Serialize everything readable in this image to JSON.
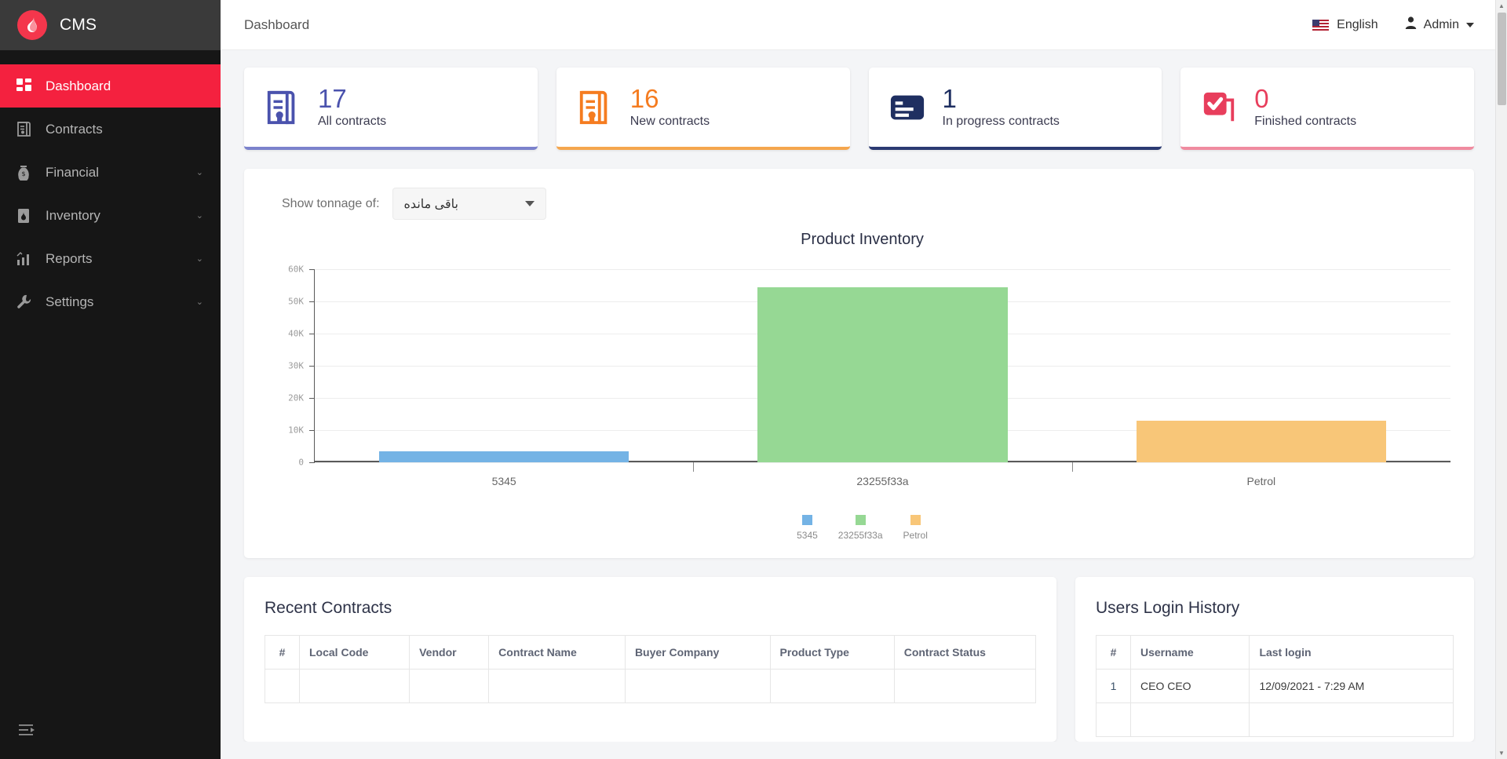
{
  "brand": {
    "title": "CMS",
    "logo_icon": "flame-logo-icon"
  },
  "sidebar": {
    "items": [
      {
        "label": "Dashboard",
        "icon": "grid-dashboard-icon",
        "active": true,
        "caret": ""
      },
      {
        "label": "Contracts",
        "icon": "contract-certificate-icon",
        "active": false,
        "caret": ""
      },
      {
        "label": "Financial",
        "icon": "money-bag-icon",
        "active": false,
        "caret": "⌄"
      },
      {
        "label": "Inventory",
        "icon": "oil-barrel-icon",
        "active": false,
        "caret": "⌄"
      },
      {
        "label": "Reports",
        "icon": "bar-chart-icon",
        "active": false,
        "caret": "⌄"
      },
      {
        "label": "Settings",
        "icon": "wrench-icon",
        "active": false,
        "caret": "⌄"
      }
    ],
    "collapse_icon": "sidebar-collapse-icon"
  },
  "topbar": {
    "breadcrumb": "Dashboard",
    "language": "English",
    "language_flag": "us-flag-icon",
    "user": "Admin",
    "user_icon": "person-icon"
  },
  "cards": [
    {
      "value": "17",
      "label": "All contracts",
      "color": "#4a52ad",
      "icon": "contract-certificate-icon"
    },
    {
      "value": "16",
      "label": "New contracts",
      "color": "#f57c20",
      "icon": "contract-certificate-icon"
    },
    {
      "value": "1",
      "label": "In progress contracts",
      "color": "#1f2f61",
      "icon": "document-lines-icon"
    },
    {
      "value": "0",
      "label": "Finished contracts",
      "color": "#e83e5c",
      "icon": "checkbox-stack-icon"
    }
  ],
  "chart_toolbar": {
    "label": "Show tonnage of:",
    "select_value": "باقی مانده",
    "select_caret_icon": "chevron-down-icon"
  },
  "chart_data": {
    "type": "bar",
    "title": "Product Inventory",
    "categories": [
      "5345",
      "23255f33a",
      "Petrol"
    ],
    "values": [
      3400,
      54500,
      13000
    ],
    "colors": [
      "#74b3e5",
      "#96d894",
      "#f8c678"
    ],
    "series": [
      {
        "name": "5345",
        "values": [
          3400,
          null,
          null
        ],
        "color": "#74b3e5"
      },
      {
        "name": "23255f33a",
        "values": [
          null,
          54500,
          null
        ],
        "color": "#96d894"
      },
      {
        "name": "Petrol",
        "values": [
          null,
          null,
          13000
        ],
        "color": "#f8c678"
      }
    ],
    "xlabel": "",
    "ylabel": "",
    "ylim": [
      0,
      60000
    ],
    "yticks": [
      "0",
      "10K",
      "20K",
      "30K",
      "40K",
      "50K",
      "60K"
    ],
    "ytick_values": [
      0,
      10000,
      20000,
      30000,
      40000,
      50000,
      60000
    ],
    "grid": true,
    "legend": {
      "position": "bottom",
      "entries": [
        "5345",
        "23255f33a",
        "Petrol"
      ]
    }
  },
  "recent_contracts": {
    "title": "Recent Contracts",
    "columns": [
      "#",
      "Local Code",
      "Vendor",
      "Contract Name",
      "Buyer Company",
      "Product Type",
      "Contract Status"
    ],
    "rows": []
  },
  "login_history": {
    "title": "Users Login History",
    "columns": [
      "#",
      "Username",
      "Last login"
    ],
    "rows": [
      {
        "index": "1",
        "username": "CEO CEO",
        "last_login": "12/09/2021 - 7:29 AM"
      }
    ]
  },
  "scrollbar": {
    "up_icon": "scroll-up-arrow-icon",
    "down_icon": "scroll-down-arrow-icon"
  }
}
